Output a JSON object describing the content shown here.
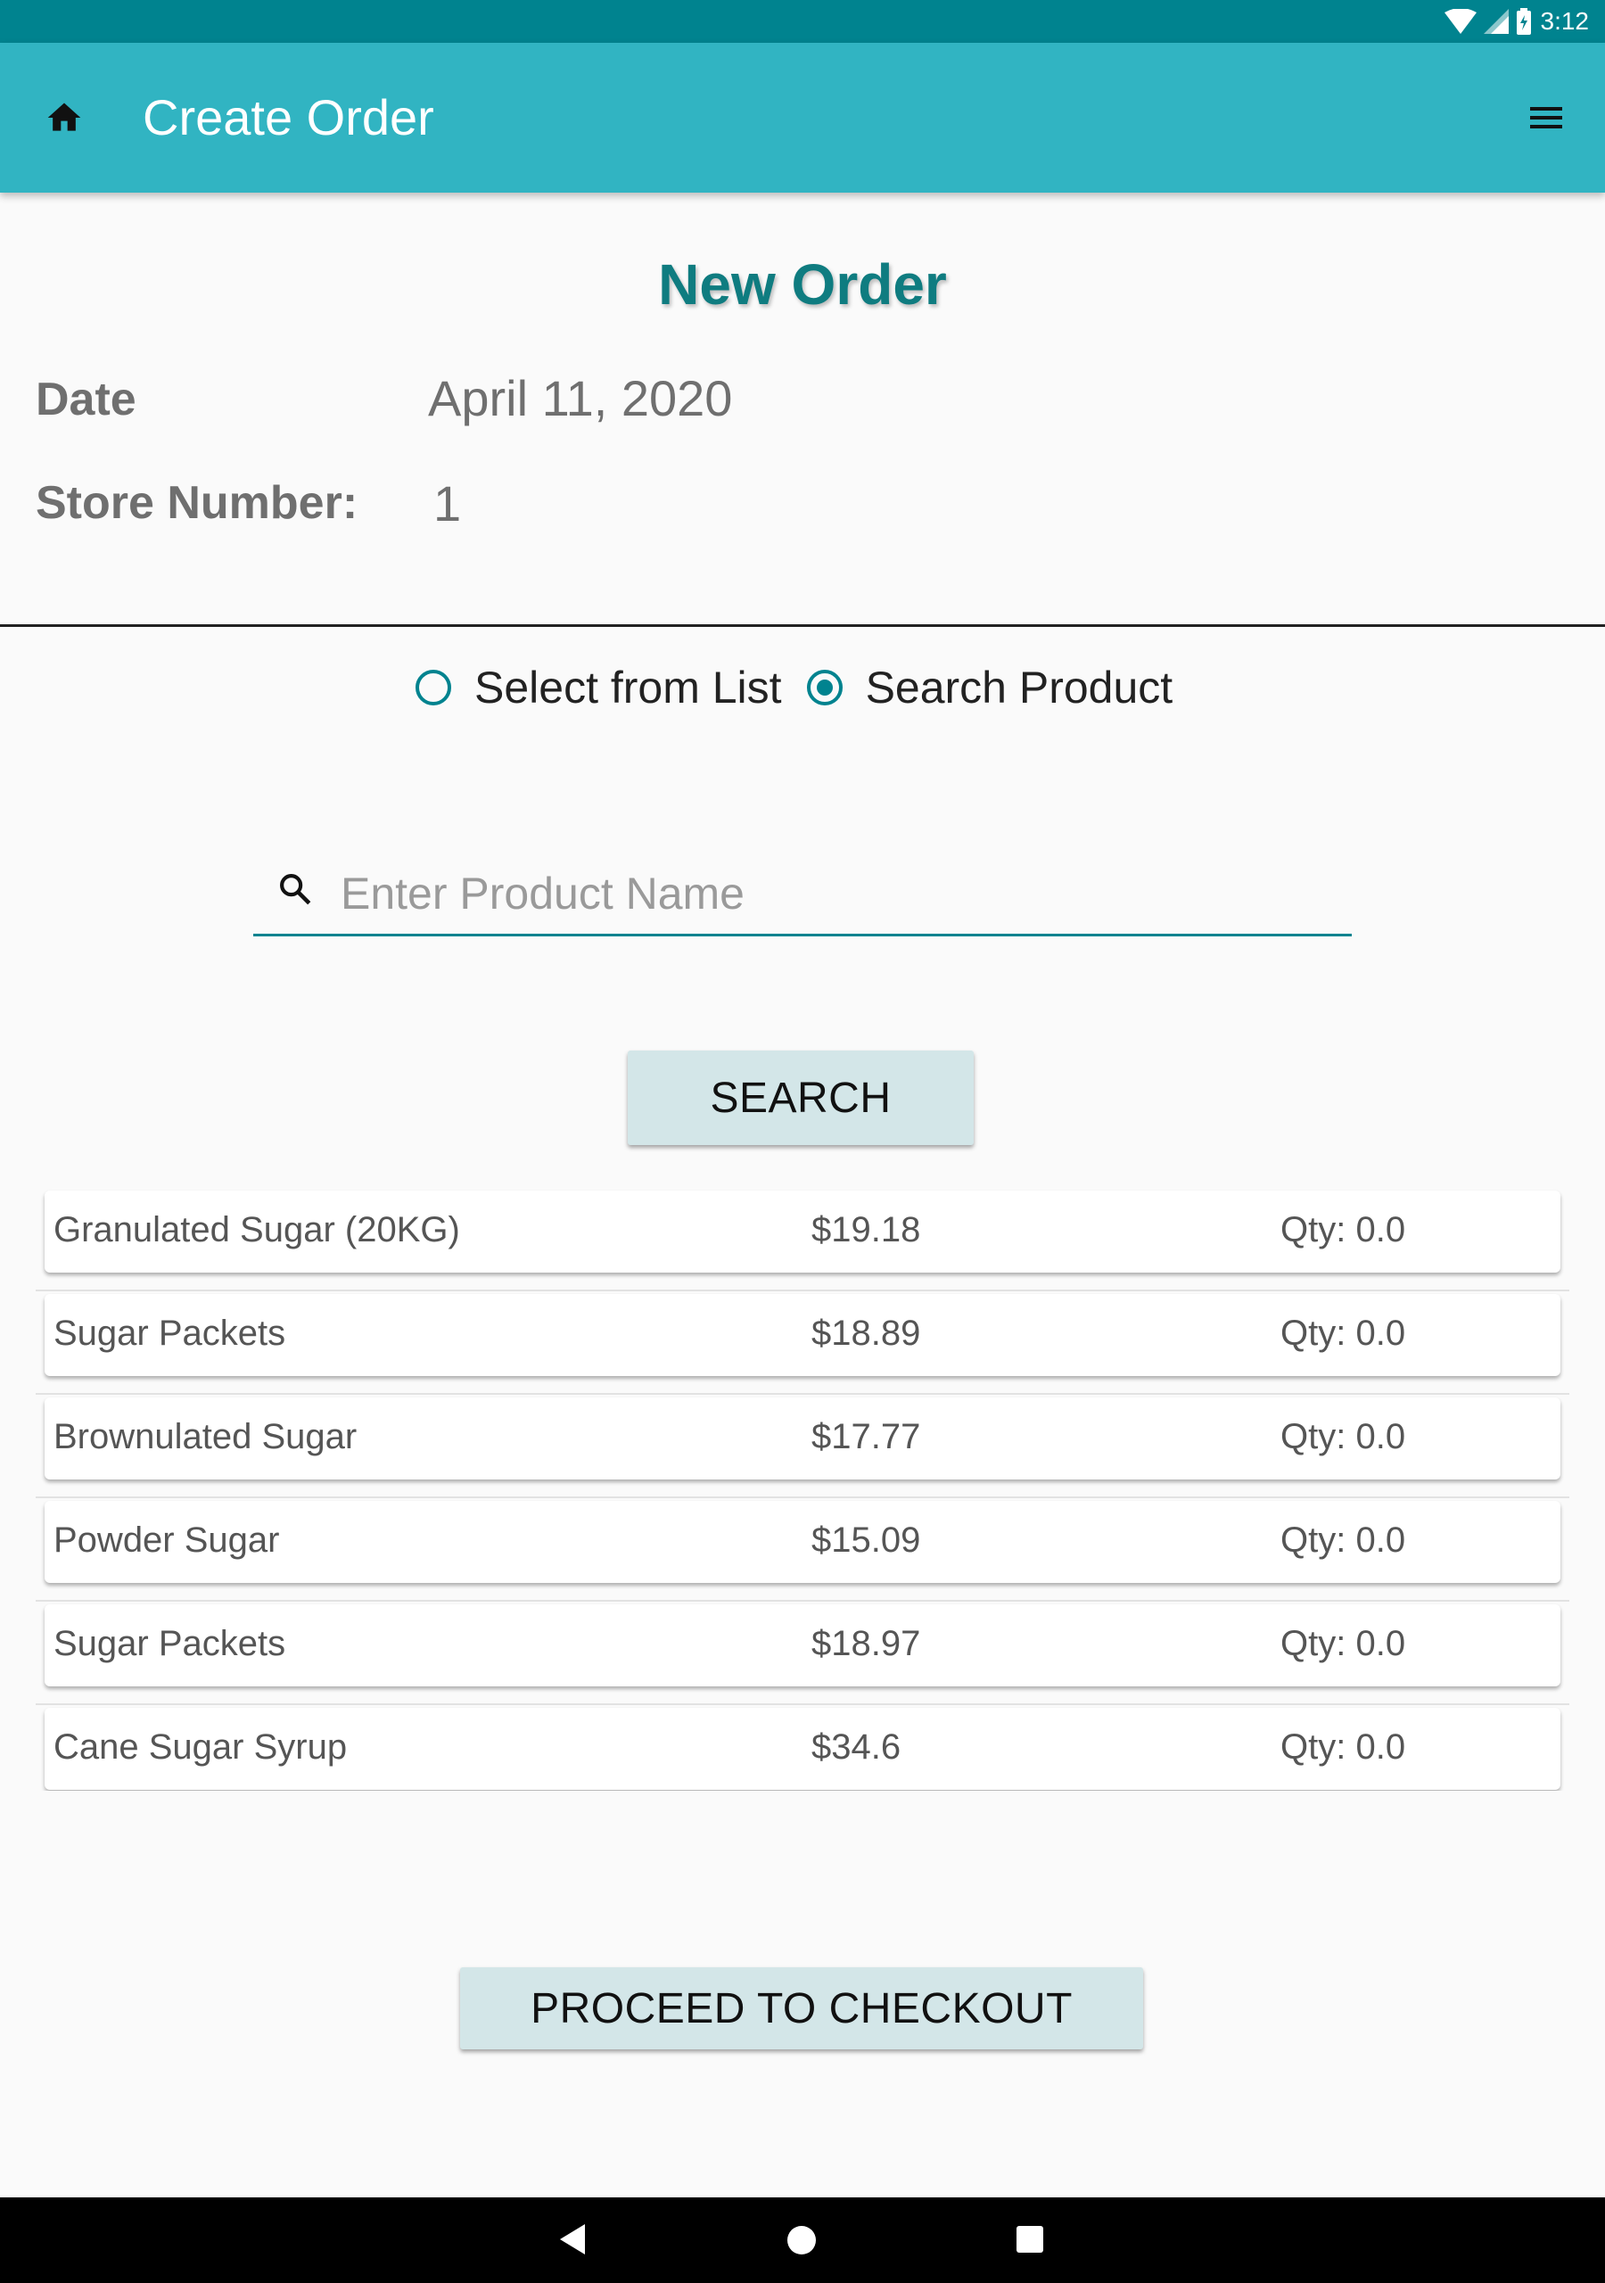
{
  "status_bar": {
    "time": "3:12"
  },
  "app_bar": {
    "title": "Create Order"
  },
  "header": {
    "title": "New Order",
    "date_label": "Date",
    "date_value": "April 11, 2020",
    "store_label": "Store Number:",
    "store_value": "1"
  },
  "mode": {
    "options": [
      {
        "label": "Select from List",
        "selected": false
      },
      {
        "label": "Search Product",
        "selected": true
      }
    ]
  },
  "search": {
    "placeholder": "Enter Product Name",
    "value": "",
    "button_label": "SEARCH"
  },
  "products": [
    {
      "name": "Granulated Sugar (20KG)",
      "price": "$19.18",
      "qty": "Qty: 0.0"
    },
    {
      "name": "Sugar Packets",
      "price": "$18.89",
      "qty": "Qty: 0.0"
    },
    {
      "name": "Brownulated Sugar",
      "price": "$17.77",
      "qty": "Qty: 0.0"
    },
    {
      "name": "Powder Sugar",
      "price": "$15.09",
      "qty": "Qty: 0.0"
    },
    {
      "name": "Sugar Packets",
      "price": "$18.97",
      "qty": "Qty: 0.0"
    },
    {
      "name": "Cane Sugar Syrup",
      "price": "$34.6",
      "qty": "Qty: 0.0"
    }
  ],
  "checkout": {
    "button_label": "PROCEED TO CHECKOUT"
  },
  "colors": {
    "status_bar": "#00838f",
    "app_bar": "#31b4c2",
    "title_accent": "#0f7c80",
    "button_bg": "#d3e6e8"
  },
  "icons": [
    "wifi-icon",
    "signal-icon",
    "battery-icon",
    "home-icon",
    "menu-icon",
    "search-icon",
    "radio-unchecked-icon",
    "radio-checked-icon",
    "back-icon",
    "nav-home-icon",
    "recents-icon"
  ]
}
